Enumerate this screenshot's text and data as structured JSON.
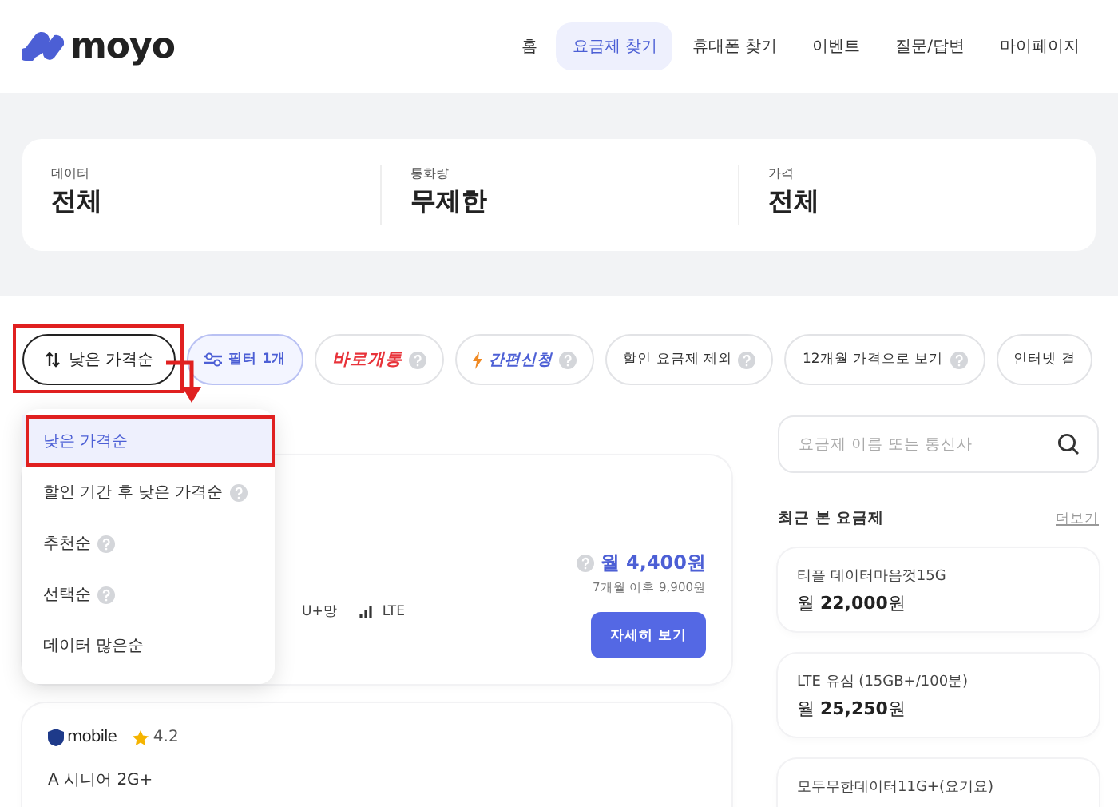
{
  "brand": {
    "name": "moyo"
  },
  "nav": [
    {
      "label": "홈",
      "selected": false
    },
    {
      "label": "요금제 찾기",
      "selected": true
    },
    {
      "label": "휴대폰 찾기",
      "selected": false
    },
    {
      "label": "이벤트",
      "selected": false
    },
    {
      "label": "질문/답변",
      "selected": false
    },
    {
      "label": "마이페이지",
      "selected": false
    }
  ],
  "summary": [
    {
      "label": "데이터",
      "value": "전체"
    },
    {
      "label": "통화량",
      "value": "무제한"
    },
    {
      "label": "가격",
      "value": "전체"
    }
  ],
  "sort_button": {
    "label": "낮은 가격순",
    "callout": true
  },
  "chips": [
    {
      "label": "필터 1개",
      "kind": "filter",
      "help": false
    },
    {
      "label": "바로개통",
      "kind": "promo",
      "help": true
    },
    {
      "label": "간편신청",
      "kind": "flash",
      "help": true
    },
    {
      "label": "할인 요금제 제외",
      "kind": "toggle",
      "help": true
    },
    {
      "label": "12개월 가격으로 보기",
      "kind": "toggle",
      "help": true
    },
    {
      "label": "인터넷 결",
      "kind": "toggle",
      "help": false
    }
  ],
  "sort_menu": {
    "items": [
      {
        "label": "낮은 가격순",
        "selected": true,
        "help": false,
        "callout": true
      },
      {
        "label": "할인 기간 후 낮은 가격순",
        "selected": false,
        "help": true,
        "callout": false
      },
      {
        "label": "추천순",
        "selected": false,
        "help": true,
        "callout": false
      },
      {
        "label": "선택순",
        "selected": false,
        "help": true,
        "callout": false
      },
      {
        "label": "데이터 많은순",
        "selected": false,
        "help": false,
        "callout": false
      }
    ]
  },
  "plans": [
    {
      "network": "U+망",
      "generation": "LTE",
      "price": "월 4,400원",
      "after": "7개월 이후 9,900원",
      "button": "자세히 보기"
    },
    {
      "brand": "mobile",
      "rating": "4.2",
      "name": "A 시니어 2G+"
    }
  ],
  "search": {
    "placeholder": "요금제 이름 또는 통신사"
  },
  "recent": {
    "title": "최근 본 요금제",
    "more": "더보기",
    "items": [
      {
        "name": "티플 데이터마음껏15G",
        "price": "월 **22,000**원"
      },
      {
        "name": "LTE 유심 (15GB+/100분)",
        "price": "월 **25,250**원"
      },
      {
        "name": "모두무한데이터11G+(요기요)"
      }
    ]
  }
}
